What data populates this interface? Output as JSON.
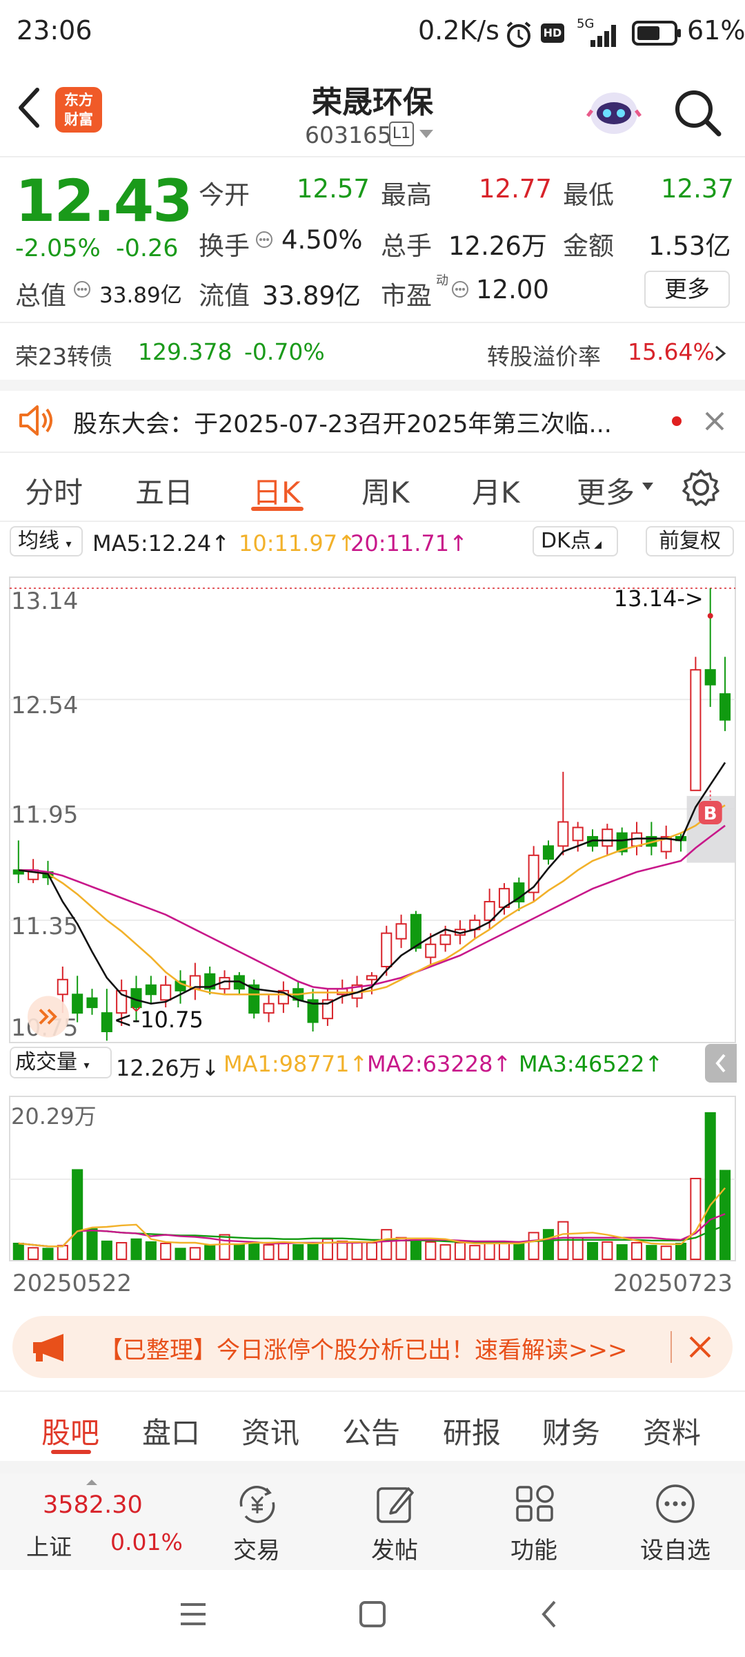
{
  "status_bar": {
    "time": "23:06",
    "speed": "0.2K/s",
    "network": "5G",
    "battery": "61%"
  },
  "header": {
    "logo_line1": "东方",
    "logo_line2": "财富",
    "stock_name": "荣晟环保",
    "stock_code": "603165",
    "level": "L1"
  },
  "quote": {
    "price": "12.43",
    "change_pct": "-2.05%",
    "change": "-0.26",
    "open_label": "今开",
    "open": "12.57",
    "high_label": "最高",
    "high": "12.77",
    "low_label": "最低",
    "low": "12.37",
    "turnover_label": "换手",
    "turnover": "4.50%",
    "volume_label": "总手",
    "volume": "12.26万",
    "amount_label": "金额",
    "amount": "1.53亿",
    "mcap_label": "总值",
    "mcap": "33.89亿",
    "float_label": "流值",
    "float": "33.89亿",
    "pe_label": "市盈",
    "pe_sup": "动",
    "pe": "12.00",
    "more_button": "更多"
  },
  "bond": {
    "name": "荣23转债",
    "price": "129.378",
    "pct": "-0.70%",
    "premium_label": "转股溢价率",
    "premium": "15.64%"
  },
  "notice": {
    "text": "股东大会：于2025-07-23召开2025年第三次临..."
  },
  "chart_tabs": [
    "分时",
    "五日",
    "日K",
    "周K",
    "月K",
    "更多"
  ],
  "active_tab": "日K",
  "kline_bar": {
    "ma_button": "均线",
    "ma5": "MA5:12.24",
    "ma10": "10:11.97",
    "ma20": "20:11.71",
    "dk_button": "DK点",
    "fq_button": "前复权"
  },
  "vol_bar": {
    "button": "成交量",
    "vol": "12.26万",
    "ma1": "MA1:98771",
    "ma2": "MA2:63228",
    "ma3": "MA3:46522"
  },
  "chart_data": {
    "type": "candlestick",
    "y_ticks": [
      "13.14",
      "12.54",
      "11.95",
      "11.35",
      "10.75"
    ],
    "ylim": [
      10.75,
      13.14
    ],
    "annotation_high": "13.14->",
    "annotation_low": "<-10.75",
    "marker": "B",
    "start_date": "20250522",
    "end_date": "20250723",
    "volume_max_label": "20.29万",
    "candles": [
      [
        11.62,
        11.6,
        11.78,
        11.55
      ],
      [
        11.57,
        11.62,
        11.68,
        11.55
      ],
      [
        11.61,
        11.58,
        11.67,
        11.54
      ],
      [
        10.95,
        11.03,
        11.1,
        10.85
      ],
      [
        10.95,
        10.85,
        11.05,
        10.8
      ],
      [
        10.93,
        10.88,
        10.98,
        10.84
      ],
      [
        10.85,
        10.75,
        10.98,
        10.7
      ],
      [
        10.85,
        10.97,
        11.03,
        10.78
      ],
      [
        10.98,
        10.88,
        11.05,
        10.8
      ],
      [
        11.0,
        10.95,
        11.05,
        10.9
      ],
      [
        10.92,
        11.0,
        11.05,
        10.88
      ],
      [
        11.02,
        10.97,
        11.08,
        10.9
      ],
      [
        10.98,
        11.05,
        11.12,
        10.92
      ],
      [
        11.06,
        10.98,
        11.1,
        10.95
      ],
      [
        10.98,
        11.04,
        11.08,
        10.95
      ],
      [
        11.05,
        10.98,
        11.07,
        10.95
      ],
      [
        11.0,
        10.85,
        11.03,
        10.82
      ],
      [
        10.85,
        10.9,
        10.95,
        10.8
      ],
      [
        10.9,
        10.97,
        11.02,
        10.85
      ],
      [
        10.98,
        10.92,
        11.02,
        10.88
      ],
      [
        10.92,
        10.8,
        10.98,
        10.75
      ],
      [
        10.82,
        10.92,
        10.98,
        10.78
      ],
      [
        10.95,
        10.98,
        11.03,
        10.9
      ],
      [
        10.93,
        11.0,
        11.05,
        10.88
      ],
      [
        11.03,
        11.05,
        11.07,
        10.95
      ],
      [
        11.1,
        11.28,
        11.32,
        11.05
      ],
      [
        11.25,
        11.33,
        11.38,
        11.2
      ],
      [
        11.38,
        11.2,
        11.4,
        11.18
      ],
      [
        11.15,
        11.22,
        11.28,
        11.1
      ],
      [
        11.22,
        11.27,
        11.32,
        11.18
      ],
      [
        11.27,
        11.3,
        11.35,
        11.22
      ],
      [
        11.3,
        11.35,
        11.38,
        11.25
      ],
      [
        11.35,
        11.45,
        11.52,
        11.3
      ],
      [
        11.42,
        11.52,
        11.55,
        11.38
      ],
      [
        11.55,
        11.45,
        11.58,
        11.4
      ],
      [
        11.5,
        11.7,
        11.75,
        11.45
      ],
      [
        11.75,
        11.68,
        11.78,
        11.65
      ],
      [
        11.75,
        11.88,
        12.15,
        11.7
      ],
      [
        11.78,
        11.85,
        11.88,
        11.72
      ],
      [
        11.8,
        11.75,
        11.84,
        11.72
      ],
      [
        11.75,
        11.84,
        11.87,
        11.7
      ],
      [
        11.82,
        11.72,
        11.85,
        11.7
      ],
      [
        11.75,
        11.82,
        11.88,
        11.7
      ],
      [
        11.8,
        11.75,
        11.88,
        11.7
      ],
      [
        11.72,
        11.8,
        11.86,
        11.68
      ],
      [
        11.8,
        11.78,
        11.82,
        11.72
      ],
      [
        12.05,
        12.7,
        12.77,
        12.05
      ],
      [
        12.7,
        12.62,
        13.14,
        12.5
      ],
      [
        12.57,
        12.43,
        12.77,
        12.37
      ]
    ],
    "ma5": [
      11.62,
      11.61,
      11.6,
      11.45,
      11.33,
      11.18,
      11.04,
      10.95,
      10.92,
      10.9,
      10.91,
      10.95,
      10.99,
      10.99,
      11.02,
      11.02,
      10.98,
      10.97,
      10.96,
      10.92,
      10.9,
      10.9,
      10.94,
      10.96,
      10.99,
      11.08,
      11.16,
      11.21,
      11.26,
      11.3,
      11.28,
      11.3,
      11.34,
      11.42,
      11.47,
      11.53,
      11.63,
      11.72,
      11.75,
      11.78,
      11.78,
      11.78,
      11.79,
      11.79,
      11.79,
      11.78,
      11.96,
      12.08,
      12.2
    ],
    "ma10": [
      11.62,
      11.61,
      11.6,
      11.55,
      11.49,
      11.42,
      11.35,
      11.29,
      11.22,
      11.15,
      11.07,
      11.01,
      10.98,
      10.96,
      10.95,
      10.95,
      10.95,
      10.95,
      10.95,
      10.95,
      10.96,
      10.96,
      10.96,
      10.96,
      10.97,
      10.99,
      11.03,
      11.07,
      11.11,
      11.14,
      11.19,
      11.25,
      11.3,
      11.36,
      11.41,
      11.45,
      11.51,
      11.56,
      11.62,
      11.67,
      11.7,
      11.73,
      11.75,
      11.77,
      11.79,
      11.82,
      11.86,
      11.92,
      11.97
    ],
    "ma20": [
      11.62,
      11.62,
      11.61,
      11.59,
      11.56,
      11.53,
      11.5,
      11.47,
      11.44,
      11.41,
      11.38,
      11.34,
      11.3,
      11.26,
      11.22,
      11.18,
      11.14,
      11.1,
      11.06,
      11.02,
      10.99,
      10.98,
      10.98,
      10.99,
      11.0,
      11.02,
      11.04,
      11.07,
      11.1,
      11.13,
      11.16,
      11.2,
      11.24,
      11.28,
      11.32,
      11.36,
      11.4,
      11.44,
      11.48,
      11.52,
      11.55,
      11.58,
      11.61,
      11.63,
      11.65,
      11.67,
      11.74,
      11.8,
      11.86
    ],
    "volume": [
      2.2,
      1.6,
      1.5,
      1.9,
      12.4,
      4.2,
      2.5,
      2.3,
      2.8,
      2.4,
      2.2,
      1.5,
      1.6,
      1.9,
      3.4,
      2.1,
      2.3,
      2.0,
      2.3,
      2.0,
      2.2,
      2.8,
      2.5,
      2.4,
      2.3,
      4.1,
      3.0,
      2.5,
      2.4,
      2.0,
      2.3,
      1.9,
      2.3,
      2.4,
      2.1,
      3.7,
      4.1,
      5.2,
      3.0,
      2.3,
      2.4,
      2.0,
      2.3,
      1.9,
      1.8,
      2.2,
      11.2,
      20.3,
      12.3
    ],
    "vol_ma1": [
      2.2,
      2.0,
      1.8,
      1.8,
      3.9,
      4.4,
      4.5,
      4.7,
      4.8,
      2.8,
      2.4,
      2.3,
      2.3,
      2.0,
      2.1,
      2.1,
      2.3,
      2.3,
      2.4,
      2.3,
      2.2,
      2.3,
      2.4,
      2.4,
      2.4,
      2.8,
      2.9,
      2.9,
      2.9,
      2.8,
      2.4,
      2.2,
      2.2,
      2.2,
      2.2,
      2.5,
      2.9,
      3.5,
      3.6,
      3.7,
      3.4,
      3.0,
      2.6,
      2.2,
      2.1,
      2.1,
      3.9,
      7.5,
      9.9
    ],
    "vol_ma2": [
      2.2,
      2.0,
      1.8,
      1.8,
      3.9,
      4.0,
      3.9,
      3.7,
      3.6,
      3.2,
      3.4,
      3.2,
      3.1,
      2.9,
      2.6,
      2.5,
      2.4,
      2.2,
      2.2,
      2.3,
      2.3,
      2.3,
      2.3,
      2.3,
      2.4,
      2.5,
      2.6,
      2.7,
      2.7,
      2.7,
      2.6,
      2.5,
      2.5,
      2.5,
      2.4,
      2.6,
      2.8,
      3.0,
      3.0,
      3.0,
      3.0,
      3.0,
      3.0,
      3.0,
      2.8,
      2.7,
      3.6,
      5.5,
      6.3
    ],
    "vol_ma3": [
      2.2,
      2.0,
      1.8,
      1.8,
      3.9,
      4.0,
      3.9,
      3.7,
      3.6,
      3.5,
      3.4,
      3.3,
      3.3,
      3.2,
      3.1,
      3.0,
      2.9,
      2.9,
      2.8,
      2.8,
      2.9,
      2.9,
      2.9,
      2.8,
      2.7,
      2.7,
      2.6,
      2.6,
      2.6,
      2.5,
      2.4,
      2.4,
      2.4,
      2.4,
      2.4,
      2.5,
      2.6,
      2.7,
      2.7,
      2.7,
      2.7,
      2.7,
      2.7,
      2.6,
      2.6,
      2.6,
      3.0,
      3.9,
      4.7
    ],
    "colors": {
      "up": "#d8232a",
      "down": "#109a10",
      "ma5": "#111111",
      "ma10": "#f2b12a",
      "ma20": "#c8188a",
      "vma1": "#f2b12a",
      "vma2": "#c8188a",
      "vma3": "#109a10"
    }
  },
  "promo": {
    "text": "【已整理】今日涨停个股分析已出！速看解读>>>"
  },
  "section_tabs": [
    "股吧",
    "盘口",
    "资讯",
    "公告",
    "研报",
    "财务",
    "资料"
  ],
  "active_section": "股吧",
  "bottom_bar": {
    "index_value": "3582.30",
    "index_name": "上证",
    "index_pct": "0.01%",
    "items": [
      {
        "label": "交易",
        "icon": "trade-icon"
      },
      {
        "label": "发帖",
        "icon": "edit-icon"
      },
      {
        "label": "功能",
        "icon": "grid-icon"
      },
      {
        "label": "设自选",
        "icon": "more-icon"
      }
    ]
  }
}
